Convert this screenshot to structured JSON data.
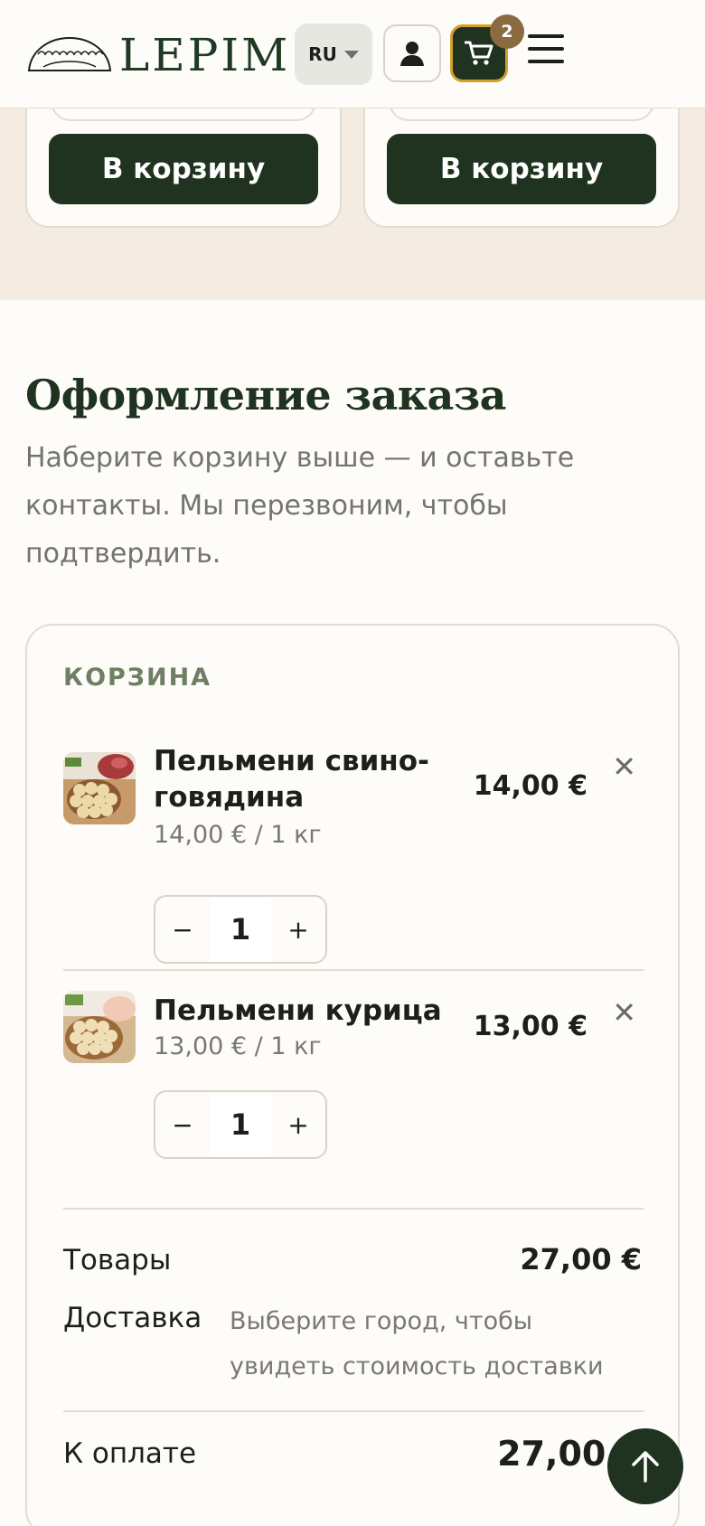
{
  "header": {
    "logo_text": "LEPIM",
    "language": "RU",
    "cart_count": "2"
  },
  "products": {
    "add_to_cart_label": "В корзину"
  },
  "checkout": {
    "title": "Оформление заказа",
    "subtitle": "Наберите корзину выше — и оставьте контакты. Мы перезвоним, чтобы подтвердить."
  },
  "cart": {
    "label": "КОРЗИНА",
    "items": [
      {
        "name": "Пельмени свино-говядина",
        "unit_price": "14,00 € / 1 кг",
        "quantity": "1",
        "total": "14,00 €"
      },
      {
        "name": "Пельмени курица",
        "unit_price": "13,00 € / 1 кг",
        "quantity": "1",
        "total": "13,00 €"
      }
    ],
    "goods_label": "Товары",
    "goods_total": "27,00 €",
    "delivery_label": "Доставка",
    "delivery_note": "Выберите город, чтобы увидеть стоимость доставки",
    "pay_label": "К оплате",
    "pay_total": "27,00 €"
  },
  "colors": {
    "brand_green": "#1f3320",
    "accent_gold": "#d4a02a",
    "badge_brown": "#8a6a3e",
    "strip_beige": "#f4ece2"
  },
  "icons": [
    "dumpling-logo-icon",
    "caret-down-icon",
    "user-icon",
    "cart-icon",
    "hamburger-menu-icon",
    "close-icon",
    "arrow-up-icon"
  ]
}
